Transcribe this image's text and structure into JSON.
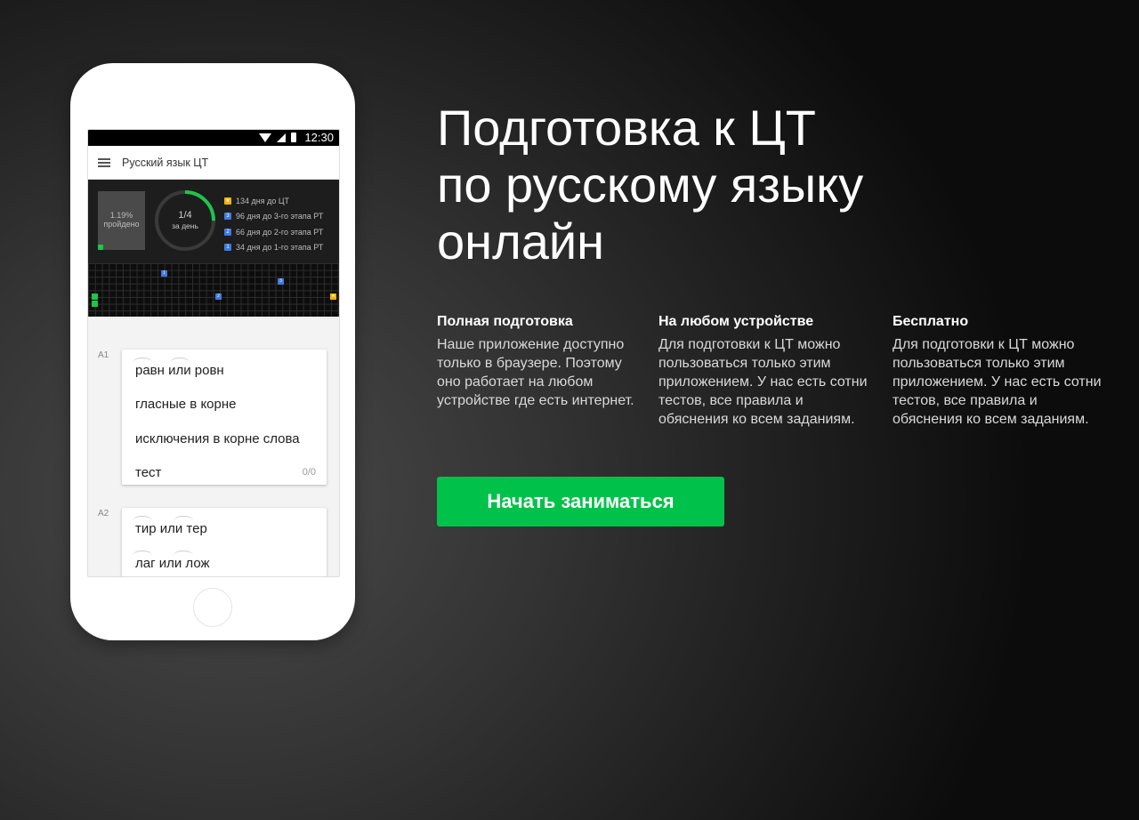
{
  "phone": {
    "status_time": "12:30",
    "app_title": "Русский язык ЦТ",
    "progress": {
      "percent_text": "1.19%",
      "label": "пройдено",
      "fraction": 0.0119
    },
    "daily": {
      "value": "1/4",
      "label": "за день",
      "fraction": 0.25
    },
    "milestones": [
      {
        "badge": "★",
        "text": "134 дня до ЦТ",
        "color": "#f5b400"
      },
      {
        "badge": "3",
        "text": "96 дня до 3-го этапа РТ",
        "color": "#3f7be0"
      },
      {
        "badge": "2",
        "text": "66 дня до 2-го этапа РТ",
        "color": "#3f7be0"
      },
      {
        "badge": "1",
        "text": "34 дня до 1-го этапа РТ",
        "color": "#3f7be0"
      }
    ],
    "grid_markers": {
      "m1": "1",
      "m2": "2",
      "m3": "3",
      "star": "★"
    },
    "tasks": [
      {
        "label": "A1",
        "items": [
          "равн или ровн",
          "гласные в корне",
          "исключения в корне слова",
          "тест"
        ],
        "count": "0/0"
      },
      {
        "label": "A2",
        "items": [
          "тир или тер",
          "лаг или лож"
        ]
      }
    ]
  },
  "hero": {
    "line1": "Подготовка к ЦТ",
    "line2": "по русскому языку",
    "line3": "онлайн"
  },
  "features": [
    {
      "title": "Полная подготовка",
      "text": "Наше приложение доступно только в браузере. Поэтому оно работает на любом устройстве где есть интернет."
    },
    {
      "title": "На любом устройстве",
      "text": "Для подготовки к ЦТ можно пользоваться только этим приложением. У нас есть сотни тестов, все правила и обяснения ко всем заданиям."
    },
    {
      "title": "Бесплатно",
      "text": "Для подготовки к ЦТ можно пользоваться только этим приложением. У нас есть сотни тестов, все правила и обяснения ко всем заданиям."
    }
  ],
  "cta": {
    "label": "Начать заниматься"
  },
  "colors": {
    "accent": "#00c24a",
    "blue": "#3f7be0",
    "star": "#f5b400"
  }
}
